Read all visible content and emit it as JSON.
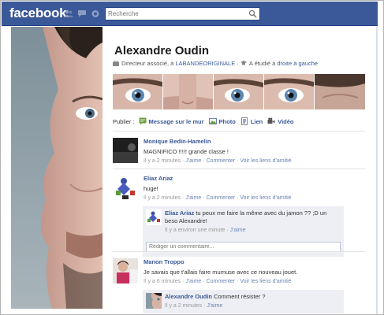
{
  "topbar": {
    "logo": "facebook",
    "search_placeholder": "Recherche",
    "jewels": [
      "friend-requests-icon",
      "messages-icon",
      "notifications-icon"
    ]
  },
  "profile": {
    "name": "Alexandre Oudin",
    "job_prefix": "Directeur associé, à",
    "company": "LABANDEORIGINALE",
    "studied_prefix": "A étudié à",
    "school": "droite à gauche"
  },
  "composer": {
    "label": "Publier :",
    "options": [
      "Message sur le mur",
      "Photo",
      "Lien",
      "Vidéo"
    ]
  },
  "posts": [
    {
      "author": "Monique Bedin-Hamelin",
      "text": "MAGNIFICO !!!!! grande classe !",
      "time": "Il y a 2 minutes",
      "like": "J'aime",
      "comment": "Commenter",
      "friendship": "Voir les liens d'amitié"
    },
    {
      "author": "Eliaz Ariaz",
      "text": "huge!",
      "time": "Il y a 2 minutes",
      "like": "J'aime",
      "comment": "Commenter",
      "friendship": "Voir les liens d'amitié",
      "reply": {
        "author": "Eliaz Ariaz",
        "text": "tu peux me faire la même avec du jamon ?? ;D un beso Alexandre!",
        "time": "Il y a environ une minute",
        "like": "J'aime"
      },
      "comment_placeholder": "Rédiger un commentaire..."
    },
    {
      "author": "Manon Troppo",
      "text": "Je savais que t'allais faire mumuse avec ce nouveau jouet.",
      "time": "Il y a 6 minutes",
      "like": "J'aime",
      "comment": "Commenter",
      "friendship": "Voir les liens d'amitié",
      "reply": {
        "author": "Alexandre Oudin",
        "text": "Comment résister ?",
        "time": "Il y a 2 minutes",
        "like": "J'aime"
      }
    }
  ],
  "colors": {
    "brand": "#3b5998",
    "link": "#3b5998",
    "comment_bg": "#edeff4"
  }
}
